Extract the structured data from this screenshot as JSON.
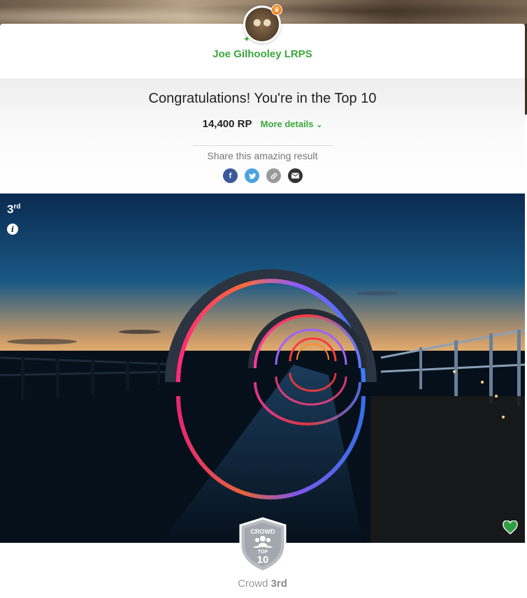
{
  "user": {
    "name": "Joe Gilhooley LRPS"
  },
  "result": {
    "headline": "Congratulations! You're in the Top 10",
    "points": "14,400 RP",
    "more_details": "More details"
  },
  "share": {
    "label": "Share this amazing result",
    "buttons": [
      {
        "name": "facebook",
        "glyph": "f",
        "color": "#3b5998"
      },
      {
        "name": "twitter",
        "glyph": "t",
        "color": "#4aa3df"
      },
      {
        "name": "copy-link",
        "glyph": "⚭",
        "color": "#9a9a9a"
      },
      {
        "name": "email",
        "glyph": "✉",
        "color": "#333333"
      }
    ]
  },
  "photo": {
    "rank_number": "3",
    "rank_suffix": "rd"
  },
  "badge": {
    "top_text": "CROWD",
    "middle_text": "TOP",
    "number": "10"
  },
  "crowd": {
    "label": "Crowd",
    "rank": "3rd"
  },
  "colors": {
    "accent_green": "#3aa83a",
    "heart_green": "#2f9e44"
  },
  "icons": {
    "crown": "crown-icon",
    "info": "info-icon",
    "heart": "heart-icon",
    "chevron": "chevron-down-icon"
  }
}
